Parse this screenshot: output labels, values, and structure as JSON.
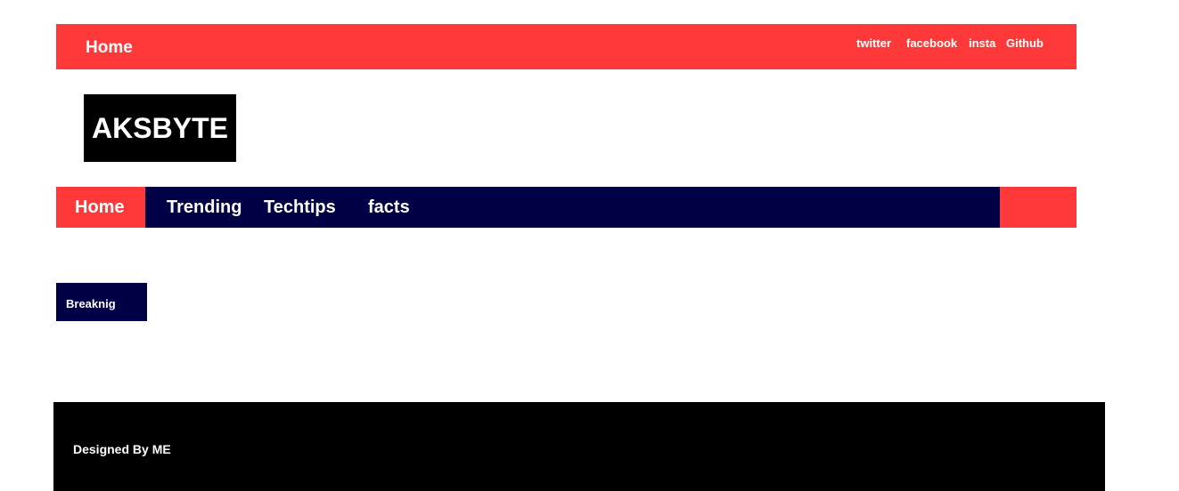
{
  "header": {
    "home_label": "Home",
    "social": {
      "twitter": "twitter",
      "facebook": "facebook",
      "insta": "insta",
      "github": "Github"
    }
  },
  "logo": {
    "text": "AKSBYTE"
  },
  "nav": {
    "items": [
      "Home",
      "Trending",
      "Techtips",
      "facts"
    ]
  },
  "breaking": {
    "label": "Breaknig"
  },
  "footer": {
    "credit": "Designed By ME"
  },
  "colors": {
    "accent_red": "#ff3939",
    "navy": "#000047",
    "black": "#000000",
    "text_white": "#ffffff"
  }
}
